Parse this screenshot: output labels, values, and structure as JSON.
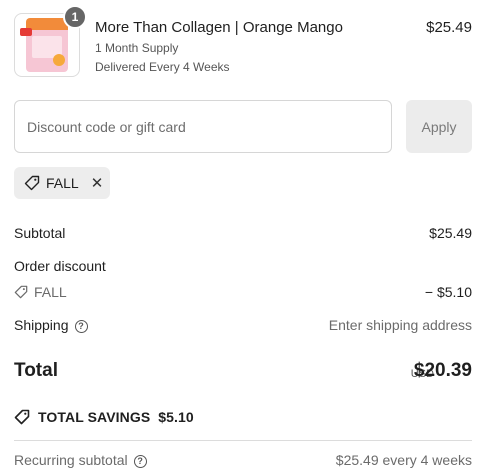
{
  "product": {
    "name": "More Than Collagen | Orange Mango",
    "quantity": "1",
    "supply": "1 Month Supply",
    "delivery": "Delivered Every 4 Weeks",
    "price": "$25.49"
  },
  "discount": {
    "placeholder": "Discount code or gift card",
    "value": "",
    "apply_label": "Apply",
    "applied_code": "FALL",
    "remove_glyph": "✕"
  },
  "summary": {
    "subtotal_label": "Subtotal",
    "subtotal_value": "$25.49",
    "order_discount_label": "Order discount",
    "discount_code": "FALL",
    "discount_value": "− $5.10",
    "shipping_label": "Shipping",
    "shipping_value": "Enter shipping address",
    "help_glyph": "?",
    "total_label": "Total",
    "currency": "USD",
    "total_value": "$20.39",
    "savings_label": "TOTAL SAVINGS",
    "savings_value": "$5.10",
    "recurring_label": "Recurring subtotal",
    "recurring_value": "$25.49 every 4 weeks"
  },
  "icons": {
    "tag": "tag-icon",
    "help": "question-circle-icon",
    "close": "close-icon"
  },
  "colors": {
    "text": "#1f1f1f",
    "muted": "#6b6b6b",
    "chip_bg": "#ededed",
    "button_bg": "#ececec",
    "quantity_badge": "#666666"
  }
}
